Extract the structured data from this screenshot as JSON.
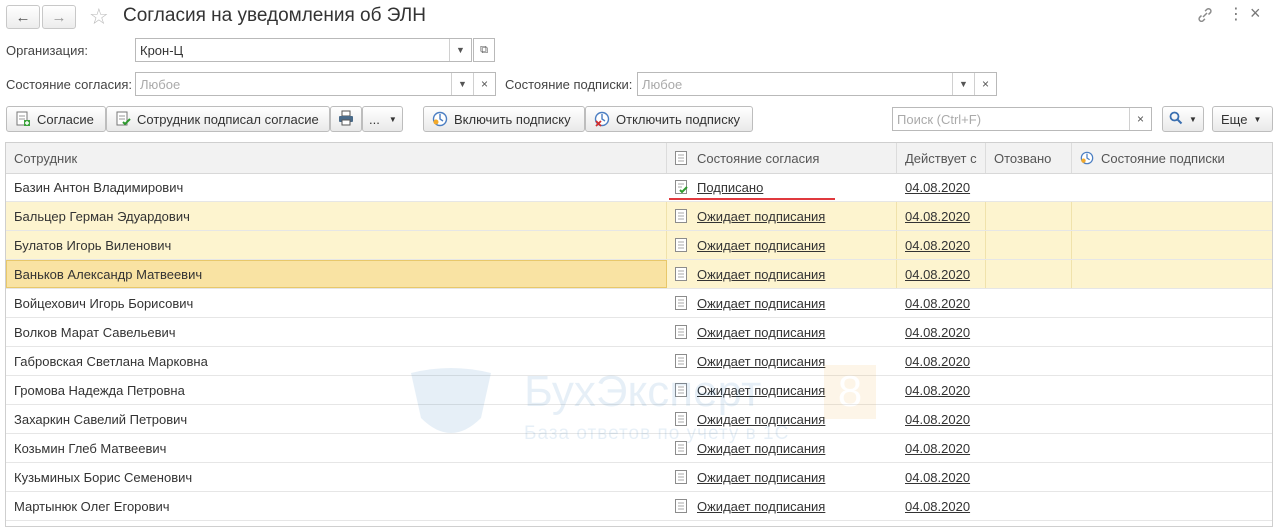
{
  "window": {
    "title": "Согласия на уведомления об ЭЛН"
  },
  "filters": {
    "org_label": "Организация:",
    "org_value": "Крон-Ц",
    "consent_state_label": "Состояние согласия:",
    "consent_state_placeholder": "Любое",
    "sub_state_label": "Состояние подписки:",
    "sub_state_placeholder": "Любое"
  },
  "toolbar": {
    "consent": "Согласие",
    "employee_signed": "Сотрудник подписал согласие",
    "more_dots": "...",
    "enable_sub": "Включить подписку",
    "disable_sub": "Отключить подписку",
    "search_placeholder": "Поиск (Ctrl+F)",
    "more": "Еще"
  },
  "columns": [
    "Сотрудник",
    "Состояние согласия",
    "Действует с",
    "Отозвано",
    "Состояние подписки"
  ],
  "watermark": {
    "brand": "БухЭксперт",
    "digit": "8",
    "tagline": "База ответов по учету в 1С"
  },
  "rows": [
    {
      "name": "Базин Антон Владимирович",
      "status": "Подписано",
      "date": "04.08.2020",
      "signed": true
    },
    {
      "name": "Бальцер Герман Эдуардович",
      "status": "Ожидает подписания",
      "date": "04.08.2020"
    },
    {
      "name": "Булатов Игорь Виленович",
      "status": "Ожидает подписания",
      "date": "04.08.2020"
    },
    {
      "name": "Ваньков Александр Матвеевич",
      "status": "Ожидает подписания",
      "date": "04.08.2020"
    },
    {
      "name": "Войцехович Игорь Борисович",
      "status": "Ожидает подписания",
      "date": "04.08.2020"
    },
    {
      "name": "Волков Марат Савельевич",
      "status": "Ожидает подписания",
      "date": "04.08.2020"
    },
    {
      "name": "Габровская Светлана Марковна",
      "status": "Ожидает подписания",
      "date": "04.08.2020"
    },
    {
      "name": "Громова Надежда Петровна",
      "status": "Ожидает подписания",
      "date": "04.08.2020"
    },
    {
      "name": "Захаркин Савелий Петрович",
      "status": "Ожидает подписания",
      "date": "04.08.2020"
    },
    {
      "name": "Козьмин Глеб Матвеевич",
      "status": "Ожидает подписания",
      "date": "04.08.2020"
    },
    {
      "name": "Кузьминых Борис Семенович",
      "status": "Ожидает подписания",
      "date": "04.08.2020"
    },
    {
      "name": "Мартынюк Олег Егорович",
      "status": "Ожидает подписания",
      "date": "04.08.2020"
    }
  ],
  "colors": {
    "highlight_row": "#fdf4cf",
    "current_row": "#f9e3a3",
    "red_underline": "#e0393e"
  }
}
